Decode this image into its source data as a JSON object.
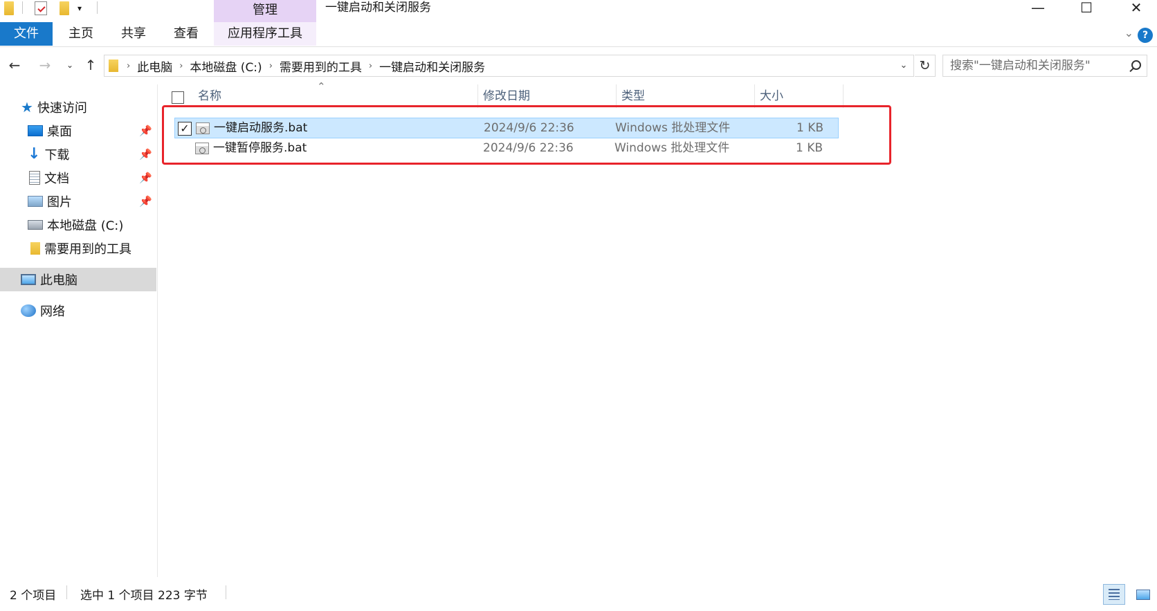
{
  "window": {
    "title": "一键启动和关闭服务",
    "manage_tab": "管理",
    "minimize": "—",
    "maximize": "☐",
    "close": "✕"
  },
  "ribbon": {
    "tabs": [
      "文件",
      "主页",
      "共享",
      "查看",
      "应用程序工具"
    ],
    "help": "?"
  },
  "address": {
    "crumbs": [
      "此电脑",
      "本地磁盘 (C:)",
      "需要用到的工具",
      "一键启动和关闭服务"
    ],
    "search_placeholder": "搜索\"一键启动和关闭服务\""
  },
  "navpane": {
    "items": [
      {
        "label": "快速访问",
        "icon": "star-icon"
      },
      {
        "label": "桌面",
        "icon": "desktop-icon",
        "pinned": true
      },
      {
        "label": "下载",
        "icon": "download-icon",
        "pinned": true
      },
      {
        "label": "文档",
        "icon": "document-icon",
        "pinned": true
      },
      {
        "label": "图片",
        "icon": "pictures-icon",
        "pinned": true
      },
      {
        "label": "本地磁盘 (C:)",
        "icon": "drive-icon"
      },
      {
        "label": "需要用到的工具",
        "icon": "folder-icon"
      },
      {
        "label": "此电脑",
        "icon": "computer-icon",
        "selected": true
      },
      {
        "label": "网络",
        "icon": "network-icon"
      }
    ]
  },
  "filelist": {
    "columns": [
      "名称",
      "修改日期",
      "类型",
      "大小"
    ],
    "rows": [
      {
        "name": "一键启动服务.bat",
        "date": "2024/9/6 22:36",
        "type": "Windows 批处理文件",
        "size": "1 KB",
        "selected": true
      },
      {
        "name": "一键暂停服务.bat",
        "date": "2024/9/6 22:36",
        "type": "Windows 批处理文件",
        "size": "1 KB",
        "selected": false
      }
    ],
    "highlight_color": "#e8242b"
  },
  "status": {
    "item_count": "2 个项目",
    "selection": "选中 1 个项目  223 字节"
  },
  "colors": {
    "accent": "#1979ca",
    "manage_tab": "#e6d3f5",
    "selection": "#cce8ff"
  }
}
